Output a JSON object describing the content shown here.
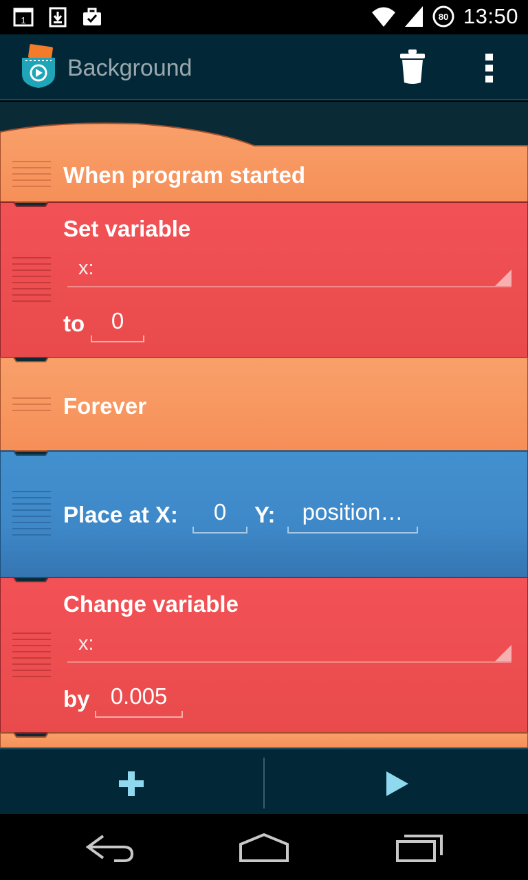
{
  "status_bar": {
    "time": "13:50",
    "battery_level": "80",
    "icons": [
      "calendar-icon",
      "download-icon",
      "briefcase-icon",
      "wifi-icon",
      "cell-signal-icon",
      "battery-icon"
    ]
  },
  "action_bar": {
    "title": "Background",
    "icons": [
      "pocket-code-logo",
      "trash-icon",
      "overflow-menu-icon"
    ]
  },
  "bricks": {
    "when_started": {
      "label": "When program started"
    },
    "set_variable": {
      "label": "Set variable",
      "variable": "x:",
      "to_label": "to",
      "value": "0"
    },
    "forever": {
      "label": "Forever"
    },
    "place_at": {
      "label_x": "Place at X:",
      "x_value": "0",
      "label_y": "Y:",
      "y_value": "position…"
    },
    "change_variable": {
      "label": "Change variable",
      "variable": "x:",
      "by_label": "by",
      "value": "0.005"
    }
  },
  "bottom_bar": {
    "icons": [
      "add-icon",
      "play-icon"
    ]
  },
  "nav_bar": {
    "icons": [
      "back-icon",
      "home-icon",
      "recents-icon"
    ]
  },
  "colors": {
    "event_orange": "#f9985f",
    "data_red": "#f04f50",
    "motion_blue": "#3f88c7",
    "toolbar_dark": "#022838",
    "accent_cyan": "#8fd8ee"
  }
}
